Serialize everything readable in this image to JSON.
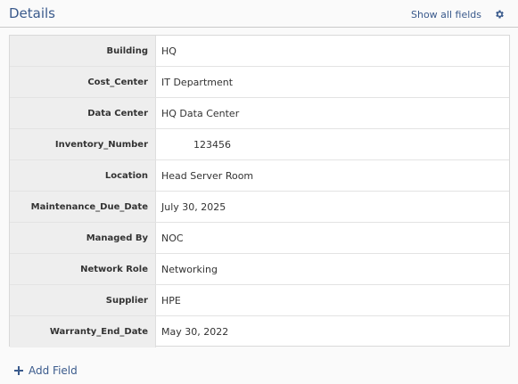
{
  "header": {
    "title": "Details",
    "show_all_label": "Show all fields",
    "settings_icon": "gear-icon"
  },
  "fields": [
    {
      "label": "Building",
      "value": "HQ"
    },
    {
      "label": "Cost_Center",
      "value": "IT Department"
    },
    {
      "label": "Data Center",
      "value": "HQ Data Center"
    },
    {
      "label": "Inventory_Number",
      "value": "123456"
    },
    {
      "label": "Location",
      "value": "Head Server Room"
    },
    {
      "label": "Maintenance_Due_Date",
      "value": "July 30, 2025"
    },
    {
      "label": "Managed By",
      "value": "NOC"
    },
    {
      "label": "Network Role",
      "value": "Networking"
    },
    {
      "label": "Supplier",
      "value": "HPE"
    },
    {
      "label": "Warranty_End_Date",
      "value": "May 30, 2022"
    }
  ],
  "footer": {
    "add_field_label": "Add Field"
  },
  "colors": {
    "accent": "#3a5a8c",
    "label_bg": "#eeeeee"
  }
}
